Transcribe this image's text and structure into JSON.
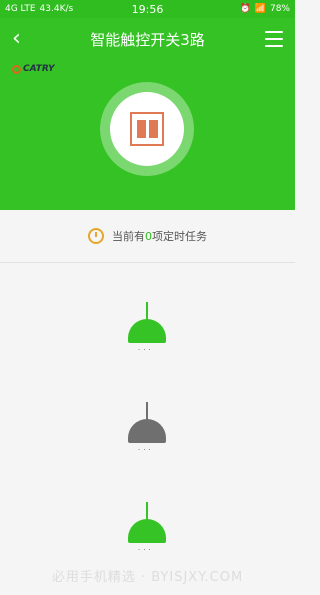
{
  "status": {
    "network": "4G LTE",
    "speed": "43.4K/s",
    "time": "19:56",
    "battery": "78%"
  },
  "header": {
    "title": "智能触控开关3路",
    "back_icon": "chevron-left-icon",
    "menu_icon": "menu-icon",
    "logo_text": "CATRY"
  },
  "timer": {
    "prefix": "当前有",
    "count": "0",
    "suffix": "项定时任务"
  },
  "lamps": [
    {
      "name": "lamp-1",
      "state": "on",
      "color": "#36c326"
    },
    {
      "name": "lamp-2",
      "state": "off",
      "color": "#6f6f6f"
    },
    {
      "name": "lamp-3",
      "state": "on",
      "color": "#36c326"
    }
  ],
  "watermark": "必用手机精选 · BYISJXY.COM"
}
